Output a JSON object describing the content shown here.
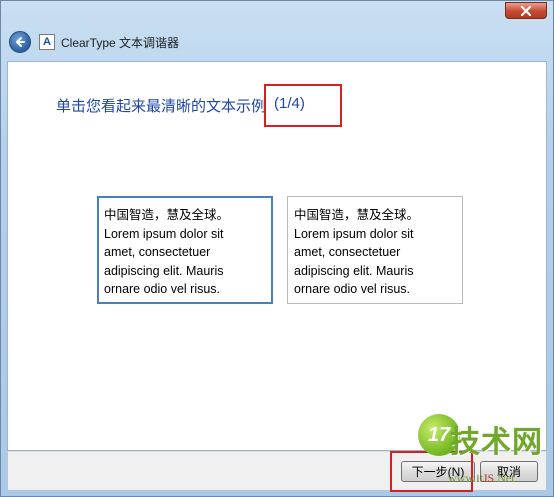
{
  "window": {
    "title": "ClearType 文本调谐器",
    "app_icon_letter": "A",
    "close_glyph": "×"
  },
  "page": {
    "heading": "单击您看起来最清晰的文本示例",
    "step": "(1/4)"
  },
  "samples": [
    {
      "state": "selected",
      "lines": [
        "中国智造，慧及全球。",
        "Lorem ipsum dolor sit",
        "amet, consectetuer",
        "adipiscing elit. Mauris",
        "ornare odio vel risus."
      ]
    },
    {
      "state": "normal",
      "lines": [
        "中国智造，慧及全球。",
        "Lorem ipsum dolor sit",
        "amet, consectetuer",
        "adipiscing elit. Mauris",
        "ornare odio vel risus."
      ]
    }
  ],
  "footer": {
    "next_label": "下一步(N)",
    "cancel_label": "取消"
  },
  "watermark": {
    "logo_text": "17",
    "title": "技术网",
    "url_prefix": "www.",
    "url_domain": "it",
    "url_suffix": "JS",
    "url_tld": ".Net"
  },
  "colors": {
    "heading": "#1f47a8",
    "highlight_box": "#d42020",
    "selected_border": "#4a7fbf"
  }
}
